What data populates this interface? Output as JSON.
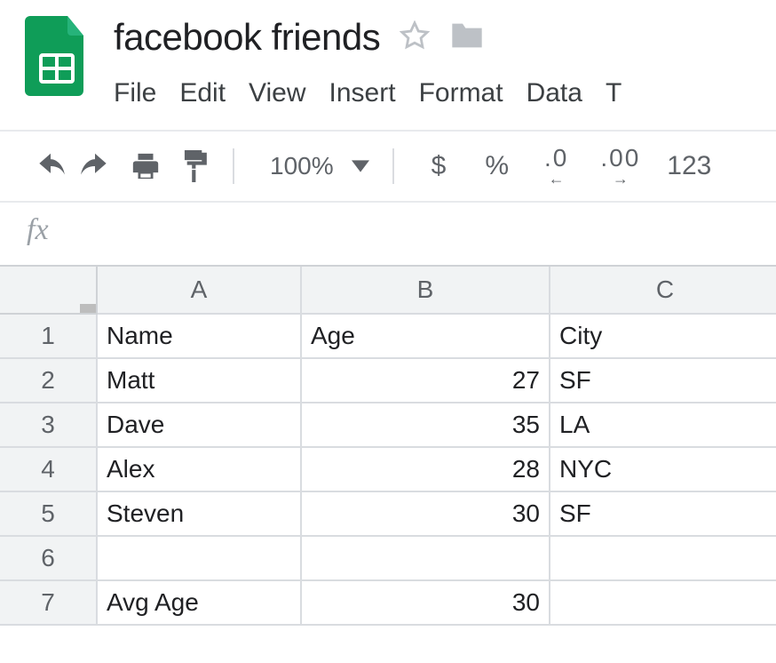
{
  "doc": {
    "title": "facebook friends"
  },
  "menu": {
    "file": "File",
    "edit": "Edit",
    "view": "View",
    "insert": "Insert",
    "format": "Format",
    "data": "Data",
    "tools": "T"
  },
  "toolbar": {
    "zoom": "100%",
    "currency": "$",
    "percent": "%",
    "dec_less": ".0",
    "dec_more": ".00",
    "numfmt": "123"
  },
  "fx": {
    "label": "fx"
  },
  "columns": {
    "A": "A",
    "B": "B",
    "C": "C"
  },
  "rows": {
    "1": "1",
    "2": "2",
    "3": "3",
    "4": "4",
    "5": "5",
    "6": "6",
    "7": "7"
  },
  "cells": {
    "A1": "Name",
    "B1": "Age",
    "C1": "City",
    "A2": "Matt",
    "B2": "27",
    "C2": "SF",
    "A3": "Dave",
    "B3": "35",
    "C3": "LA",
    "A4": "Alex",
    "B4": "28",
    "C4": "NYC",
    "A5": "Steven",
    "B5": "30",
    "C5": "SF",
    "A6": "",
    "B6": "",
    "C6": "",
    "A7": "Avg Age",
    "B7": "30",
    "C7": ""
  },
  "chart_data": {
    "type": "table",
    "columns": [
      "Name",
      "Age",
      "City"
    ],
    "rows": [
      {
        "Name": "Matt",
        "Age": 27,
        "City": "SF"
      },
      {
        "Name": "Dave",
        "Age": 35,
        "City": "LA"
      },
      {
        "Name": "Alex",
        "Age": 28,
        "City": "NYC"
      },
      {
        "Name": "Steven",
        "Age": 30,
        "City": "SF"
      }
    ],
    "summary": {
      "label": "Avg Age",
      "value": 30
    }
  }
}
